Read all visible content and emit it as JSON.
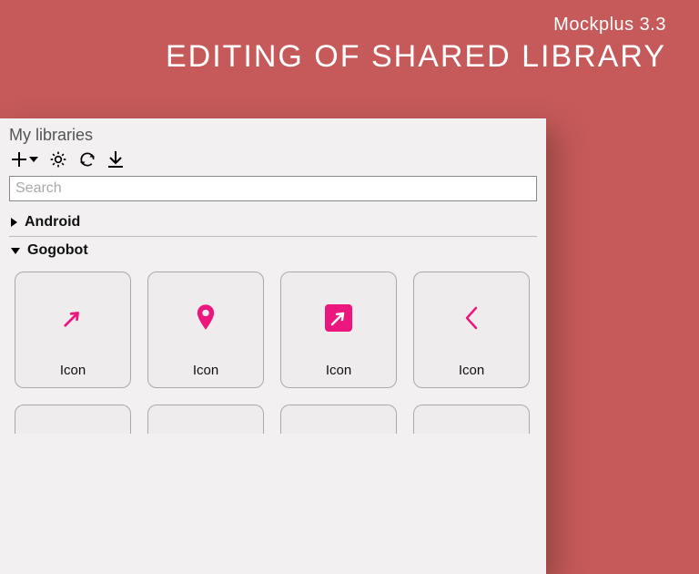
{
  "hero": {
    "version": "Mockplus 3.3",
    "title": "EDITING OF SHARED LIBRARY"
  },
  "panel": {
    "title": "My libraries",
    "search_placeholder": "Search"
  },
  "sections": {
    "android": {
      "name": "Android",
      "expanded": false
    },
    "gogobot": {
      "name": "Gogobot",
      "expanded": true,
      "items": [
        {
          "label": "Icon",
          "glyph": "arrow-ne"
        },
        {
          "label": "Icon",
          "glyph": "pin"
        },
        {
          "label": "Icon",
          "glyph": "square-arrow"
        },
        {
          "label": "Icon",
          "glyph": "chevron-left"
        }
      ]
    }
  },
  "colors": {
    "accent": "#ec167f",
    "bg": "#c65a5a"
  }
}
